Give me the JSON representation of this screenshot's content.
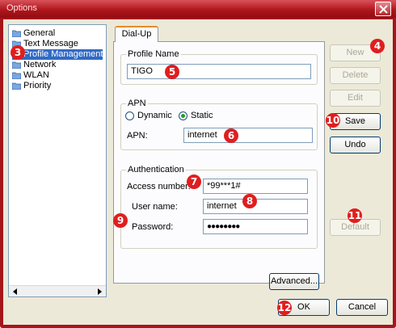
{
  "window": {
    "title": "Options",
    "accent": "#a5161b"
  },
  "sidebar": {
    "items": [
      {
        "label": "General",
        "icon": "folder-icon"
      },
      {
        "label": "Text Message",
        "icon": "folder-icon"
      },
      {
        "label": "Profile Management",
        "icon": "folder-icon",
        "selected": true
      },
      {
        "label": "Network",
        "icon": "folder-icon"
      },
      {
        "label": "WLAN",
        "icon": "folder-icon"
      },
      {
        "label": "Priority",
        "icon": "folder-icon"
      }
    ]
  },
  "tabs": [
    {
      "label": "Dial-Up",
      "active": true
    }
  ],
  "profile": {
    "group_label": "Profile Name",
    "value": "TIGO"
  },
  "apn": {
    "group_label": "APN",
    "dynamic_label": "Dynamic",
    "static_label": "Static",
    "selected": "Static",
    "field_label": "APN:",
    "value": "internet"
  },
  "auth": {
    "group_label": "Authentication",
    "access_label": "Access number:",
    "access_value": "*99***1#",
    "user_label": "User name:",
    "user_value": "internet",
    "password_label": "Password:",
    "password_value": "●●●●●●●●"
  },
  "buttons": {
    "new": "New",
    "delete": "Delete",
    "edit": "Edit",
    "save": "Save",
    "undo": "Undo",
    "default": "Default",
    "advanced": "Advanced...",
    "ok": "OK",
    "cancel": "Cancel"
  },
  "annotations": [
    "3",
    "4",
    "5",
    "6",
    "7",
    "8",
    "9",
    "10",
    "11",
    "12"
  ]
}
